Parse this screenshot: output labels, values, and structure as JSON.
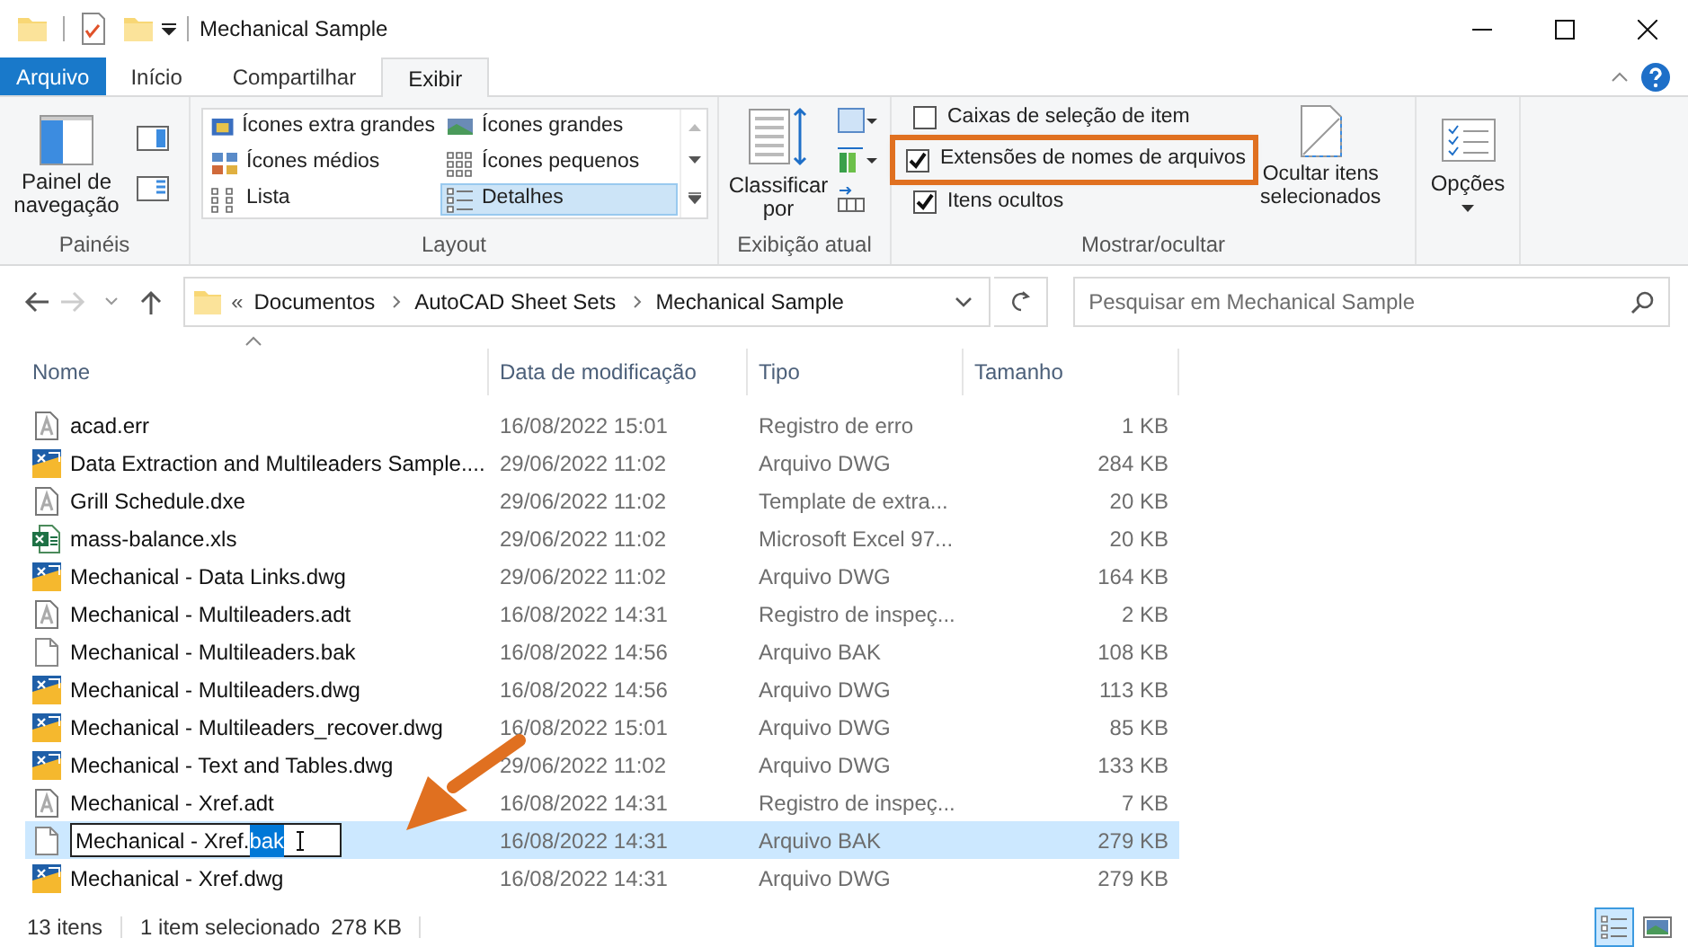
{
  "window": {
    "title": "Mechanical Sample"
  },
  "ribbon": {
    "tabs": [
      {
        "label": "Arquivo",
        "kind": "file",
        "selected": false
      },
      {
        "label": "Início",
        "kind": "tab",
        "selected": false
      },
      {
        "label": "Compartilhar",
        "kind": "tab",
        "selected": false
      },
      {
        "label": "Exibir",
        "kind": "tab",
        "selected": true
      }
    ],
    "panes_group": {
      "button": "Painel de\nnavegação",
      "label": "Painéis"
    },
    "layout_group": {
      "options": [
        {
          "label": "Ícones extra grandes",
          "selected": false
        },
        {
          "label": "Ícones grandes",
          "selected": false
        },
        {
          "label": "Ícones médios",
          "selected": false
        },
        {
          "label": "Ícones pequenos",
          "selected": false
        },
        {
          "label": "Lista",
          "selected": false
        },
        {
          "label": "Detalhes",
          "selected": true
        }
      ],
      "label": "Layout"
    },
    "current_view_group": {
      "button": "Classificar\npor",
      "label": "Exibição atual"
    },
    "show_hide_group": {
      "checkboxes": [
        {
          "label": "Caixas de seleção de item",
          "checked": false,
          "highlighted": false
        },
        {
          "label": "Extensões de nomes de arquivos",
          "checked": true,
          "highlighted": true
        },
        {
          "label": "Itens ocultos",
          "checked": true,
          "highlighted": false
        }
      ],
      "button": "Ocultar itens\nselecionados",
      "label": "Mostrar/ocultar"
    },
    "options_button": "Opções"
  },
  "address": {
    "prefix": "«",
    "path": [
      "Documentos",
      "AutoCAD Sheet Sets",
      "Mechanical Sample"
    ],
    "search_placeholder": "Pesquisar em Mechanical Sample"
  },
  "table": {
    "columns": [
      "Nome",
      "Data de modificação",
      "Tipo",
      "Tamanho"
    ],
    "rows": [
      {
        "kind": "autocad",
        "name": "acad.err",
        "date": "16/08/2022 15:01",
        "type": "Registro de erro",
        "size": "1 KB",
        "selected": false
      },
      {
        "kind": "dwg",
        "name": "Data Extraction and Multileaders Sample....",
        "date": "29/06/2022 11:02",
        "type": "Arquivo DWG",
        "size": "284 KB",
        "selected": false
      },
      {
        "kind": "autocad",
        "name": "Grill Schedule.dxe",
        "date": "29/06/2022 11:02",
        "type": "Template de extra...",
        "size": "20 KB",
        "selected": false
      },
      {
        "kind": "excel",
        "name": "mass-balance.xls",
        "date": "29/06/2022 11:02",
        "type": "Microsoft Excel 97...",
        "size": "20 KB",
        "selected": false
      },
      {
        "kind": "dwg",
        "name": "Mechanical - Data Links.dwg",
        "date": "29/06/2022 11:02",
        "type": "Arquivo DWG",
        "size": "164 KB",
        "selected": false
      },
      {
        "kind": "autocad",
        "name": "Mechanical - Multileaders.adt",
        "date": "16/08/2022 14:31",
        "type": "Registro de inspeç...",
        "size": "2 KB",
        "selected": false
      },
      {
        "kind": "blank",
        "name": "Mechanical - Multileaders.bak",
        "date": "16/08/2022 14:56",
        "type": "Arquivo BAK",
        "size": "108 KB",
        "selected": false
      },
      {
        "kind": "dwg",
        "name": "Mechanical - Multileaders.dwg",
        "date": "16/08/2022 14:56",
        "type": "Arquivo DWG",
        "size": "113 KB",
        "selected": false
      },
      {
        "kind": "dwg",
        "name": "Mechanical - Multileaders_recover.dwg",
        "date": "16/08/2022 15:01",
        "type": "Arquivo DWG",
        "size": "85 KB",
        "selected": false
      },
      {
        "kind": "dwg",
        "name": "Mechanical - Text and Tables.dwg",
        "date": "29/06/2022 11:02",
        "type": "Arquivo DWG",
        "size": "133 KB",
        "selected": false
      },
      {
        "kind": "autocad",
        "name": "Mechanical - Xref.adt",
        "date": "16/08/2022 14:31",
        "type": "Registro de inspeç...",
        "size": "7 KB",
        "selected": false
      },
      {
        "kind": "blank",
        "rename": {
          "text": "Mechanical - Xref.",
          "selection": "bak"
        },
        "date": "16/08/2022 14:31",
        "type": "Arquivo BAK",
        "size": "279 KB",
        "selected": true
      },
      {
        "kind": "dwg",
        "name": "Mechanical - Xref.dwg",
        "date": "16/08/2022 14:31",
        "type": "Arquivo DWG",
        "size": "279 KB",
        "selected": false
      }
    ]
  },
  "status_bar": {
    "count": "13 itens",
    "selection": "1 item selecionado",
    "size": "278 KB",
    "views": [
      {
        "kind": "details",
        "selected": true
      },
      {
        "kind": "large",
        "selected": false
      }
    ]
  }
}
